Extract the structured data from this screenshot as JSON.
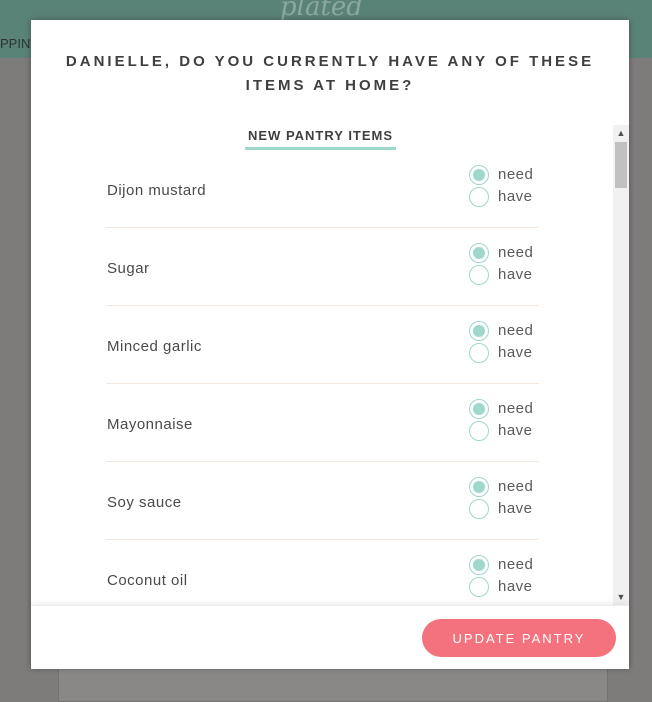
{
  "background": {
    "logo": "plated",
    "tab_label": "PPING"
  },
  "modal": {
    "title_line1": "DANIELLE, DO YOU CURRENTLY HAVE ANY OF THESE",
    "title_line2": "ITEMS AT HOME?",
    "section_title": "NEW PANTRY ITEMS",
    "option_need": "need",
    "option_have": "have",
    "items": [
      {
        "name": "Dijon mustard",
        "selected": "need"
      },
      {
        "name": "Sugar",
        "selected": "need"
      },
      {
        "name": "Minced garlic",
        "selected": "need"
      },
      {
        "name": "Mayonnaise",
        "selected": "need"
      },
      {
        "name": "Soy sauce",
        "selected": "need"
      },
      {
        "name": "Coconut oil",
        "selected": "need"
      }
    ],
    "update_button": "UPDATE PANTRY"
  },
  "colors": {
    "accent": "#9ed7cc",
    "button": "#f4727d",
    "header": "#5a8378"
  }
}
